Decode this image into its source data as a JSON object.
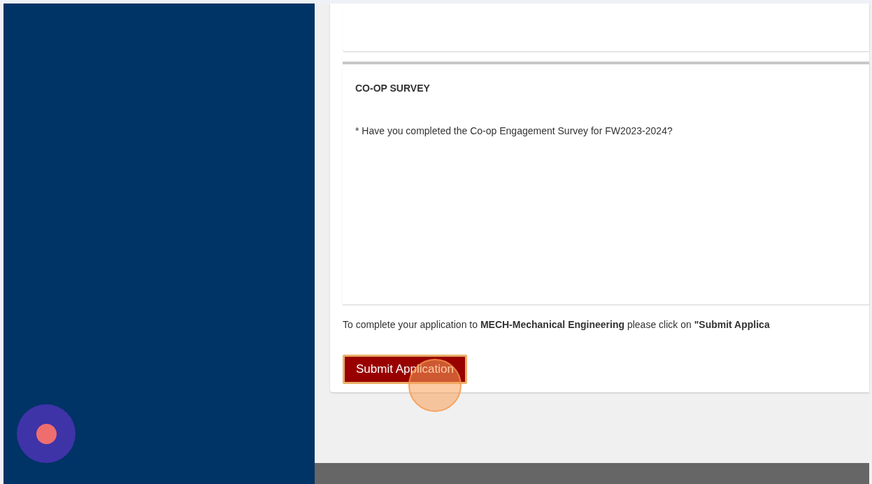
{
  "survey": {
    "title": "CO-OP SURVEY",
    "question": "* Have you completed the Co-op Engagement Survey for FW2023-2024?"
  },
  "instructions": "To complete your application to **MECH-Mechanical Engineering** please click on **\"Submit Applica**",
  "submit_button": {
    "label": "Submit Application"
  }
}
